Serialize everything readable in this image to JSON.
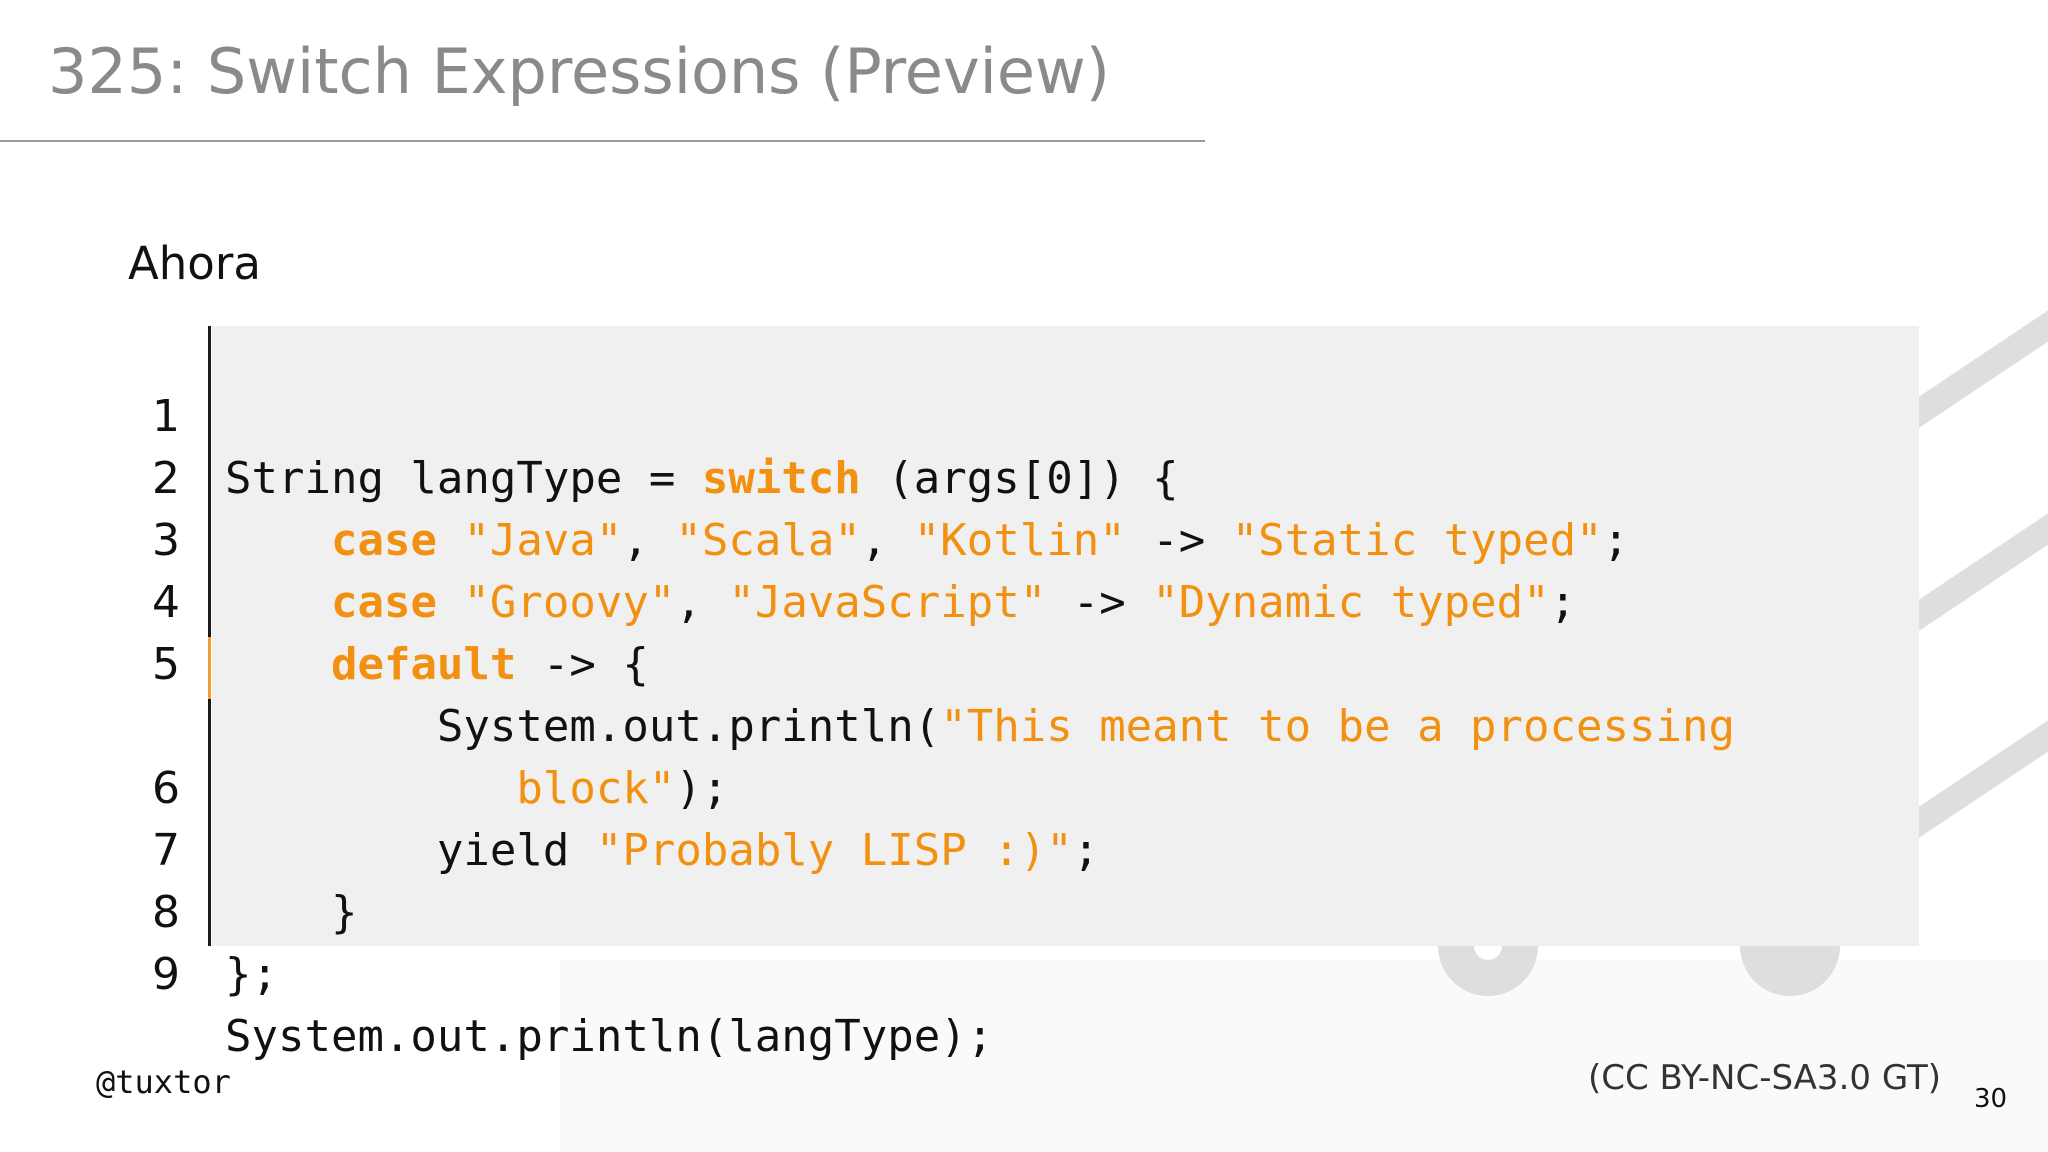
{
  "slide": {
    "title": "325: Switch Expressions (Preview)",
    "subtitle": "Ahora",
    "handle": "@tuxtor",
    "license": "(CC BY-NC-SA3.0 GT)",
    "page_number": "30"
  },
  "code": {
    "language": "java",
    "keyword_color": "#f29111",
    "string_color": "#f29111",
    "text_color": "#111111",
    "background_color": "#f0f0f0",
    "lines": [
      {
        "number": "1",
        "t1": "String langType = ",
        "k1": "switch",
        "t2": " (args[0]) {"
      },
      {
        "number": "2",
        "t1": "    ",
        "k1": "case",
        "t2": " ",
        "s1": "\"Java\"",
        "t3": ", ",
        "s2": "\"Scala\"",
        "t4": ", ",
        "s3": "\"Kotlin\"",
        "t5": " -> ",
        "s4": "\"Static typed\"",
        "t6": ";"
      },
      {
        "number": "3",
        "t1": "    ",
        "k1": "case",
        "t2": " ",
        "s1": "\"Groovy\"",
        "t3": ", ",
        "s2": "\"JavaScript\"",
        "t4": " -> ",
        "s3": "\"Dynamic typed\"",
        "t5": ";"
      },
      {
        "number": "4",
        "t1": "    ",
        "k1": "default",
        "t2": " -> {"
      },
      {
        "number": "5",
        "t1": "        System.out.println(",
        "s1": "\"This meant to be a processing"
      },
      {
        "number": "",
        "t1": "           ",
        "s1": "block\"",
        "t2": ");"
      },
      {
        "number": "6",
        "t1": "        yield ",
        "s1": "\"Probably LISP :)\"",
        "t2": ";"
      },
      {
        "number": "7",
        "t1": "    }"
      },
      {
        "number": "8",
        "t1": "};"
      },
      {
        "number": "9",
        "t1": "System.out.println(langType);"
      }
    ]
  }
}
